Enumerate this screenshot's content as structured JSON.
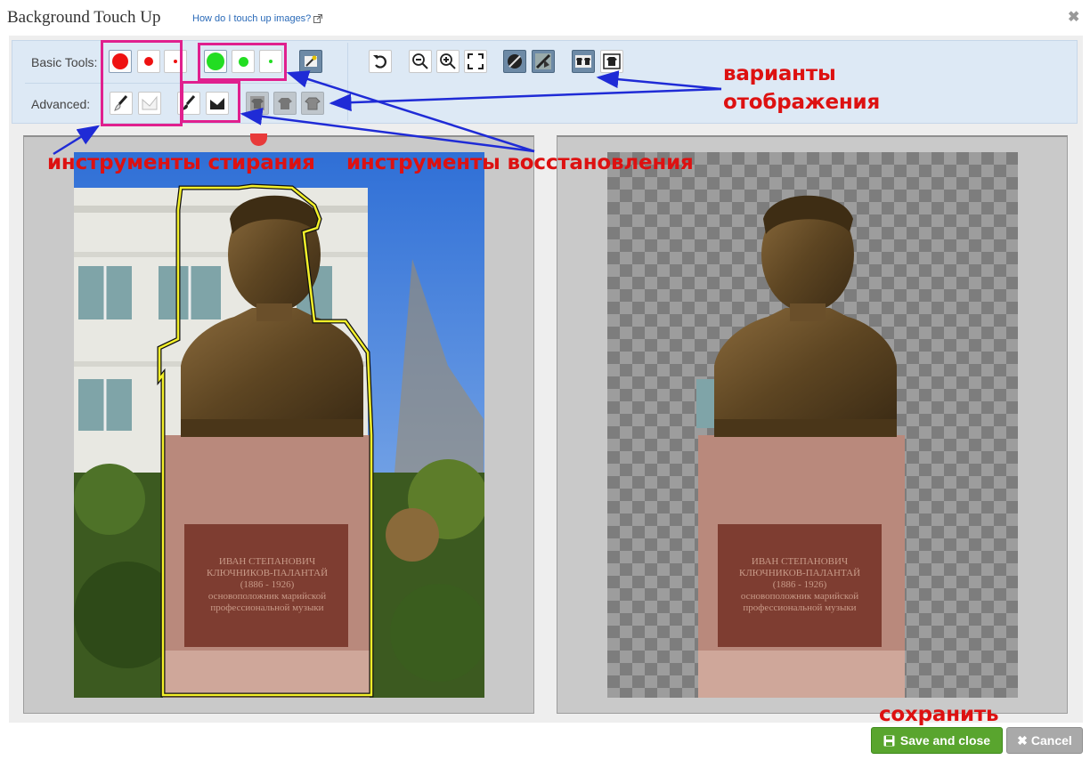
{
  "dialog": {
    "title": "Background Touch Up",
    "help_link": "How do I touch up images?"
  },
  "toolbar": {
    "basic_label": "Basic Tools:",
    "advanced_label": "Advanced:"
  },
  "annotations": {
    "display_variants_line1": "варианты",
    "display_variants_line2": "отображения",
    "erase_tools": "инструменты стирания",
    "restore_tools": "инструменты восстановления",
    "save": "сохранить"
  },
  "plaque": {
    "line1": "ИВАН СТЕПАНОВИЧ",
    "line2": "КЛЮЧНИКОВ-ПАЛАНТАЙ",
    "line3": "(1886 - 1926)",
    "line4": "основоположник марийской",
    "line5": "профессиональной музыки"
  },
  "buttons": {
    "save": "Save and close",
    "cancel": "Cancel"
  },
  "colors": {
    "erase": "#ee1111",
    "restore": "#22dd22",
    "highlight": "#e0208e",
    "arrow": "#1f2bd6",
    "annotation": "#dd1111",
    "save_button": "#59a52e"
  }
}
